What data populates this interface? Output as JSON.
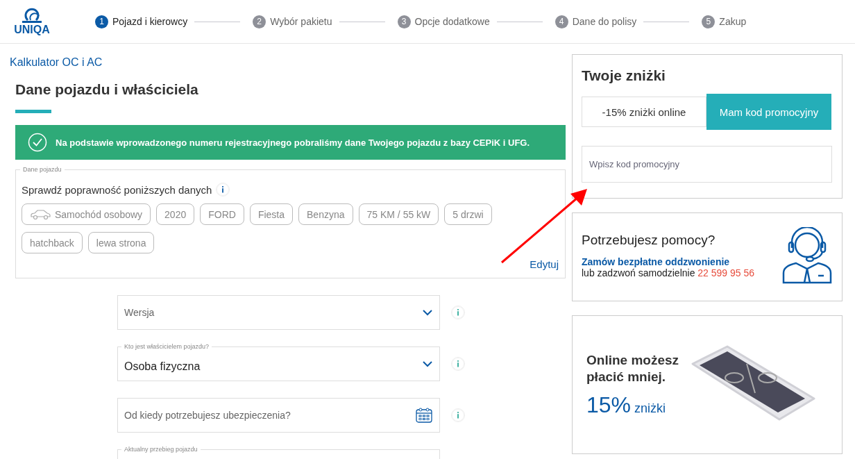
{
  "header": {
    "logo": "UNIQA",
    "steps": [
      {
        "number": "1",
        "label": "Pojazd i kierowcy",
        "selected": true
      },
      {
        "number": "2",
        "label": "Wybór pakietu",
        "selected": false
      },
      {
        "number": "3",
        "label": "Opcje dodatkowe",
        "selected": false
      },
      {
        "number": "4",
        "label": "Dane do polisy",
        "selected": false
      },
      {
        "number": "5",
        "label": "Zakup",
        "selected": false
      }
    ]
  },
  "breadcrumb": "Kalkulator OC i AC",
  "page_title": "Dane pojazdu i właściciela",
  "success_message": "Na podstawie wprowadzonego numeru rejestracyjnego pobraliśmy dane Twojego pojazdu z bazy CEPiK i UFG.",
  "vehicle": {
    "legend": "Dane pojazdu",
    "heading": "Sprawdź poprawność poniższych danych",
    "tags": [
      {
        "label": "Samochód osobowy",
        "kind": "car"
      },
      {
        "label": "2020",
        "kind": "plain"
      },
      {
        "label": "FORD",
        "kind": "plain"
      },
      {
        "label": "Fiesta",
        "kind": "plain"
      },
      {
        "label": "Benzyna",
        "kind": "plain"
      },
      {
        "label": "75 KM / 55 kW",
        "kind": "plain"
      },
      {
        "label": "5 drzwi",
        "kind": "plain"
      },
      {
        "label": "hatchback",
        "kind": "plain"
      },
      {
        "label": "lewa strona",
        "kind": "plain"
      }
    ],
    "edit_link": "Edytuj"
  },
  "fields": [
    {
      "kind": "select",
      "placeholder": "Wersja"
    },
    {
      "kind": "select",
      "label": "Kto jest właścicielem pojazdu?",
      "value": "Osoba fizyczna"
    },
    {
      "kind": "date",
      "placeholder": "Od kiedy potrzebujesz ubezpieczenia?"
    },
    {
      "kind": "text",
      "label": "Aktualny przebieg pojazdu"
    }
  ],
  "discounts": {
    "title": "Twoje zniżki",
    "options": [
      {
        "label": "-15% zniżki online",
        "selected": false
      },
      {
        "label": "Mam kod promocyjny",
        "selected": true
      }
    ],
    "promo_placeholder": "Wpisz kod promocyjny"
  },
  "help": {
    "title": "Potrzebujesz pomocy?",
    "callback_link": "Zamów bezpłatne oddzwonienie",
    "call_text": "lub zadzwoń samodzielnie",
    "phone": "22 599 95 56"
  },
  "promo_banner": {
    "line_1": "Online możesz",
    "line_2": "płacić mniej.",
    "percent": "15%",
    "suffix": "zniżki"
  }
}
